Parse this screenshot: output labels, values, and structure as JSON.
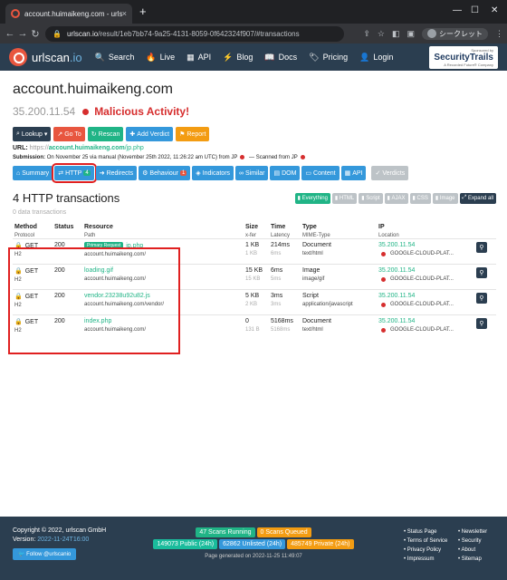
{
  "browser": {
    "tab_title": "account.huimaikeng.com - urlsc",
    "tab_close": "×",
    "new_tab": "+",
    "url_domain": "urlscan.io",
    "url_path": "/result/1eb7bb74-9a25-4131-8059-0f642324f907/#transactions",
    "profile_label": "シークレット"
  },
  "site_nav": {
    "logo_main": "urlscan",
    "logo_suffix": ".io",
    "items": [
      "Search",
      "Live",
      "API",
      "Blog",
      "Docs",
      "Pricing",
      "Login"
    ],
    "sponsor_small": "Sponsored by",
    "sponsor_name": "SecurityTrails",
    "sponsor_sub": "A Recorded Future® Company"
  },
  "page": {
    "domain": "account.huimaikeng.com",
    "ip": "35.200.11.54",
    "verdict": "Malicious Activity!"
  },
  "actions": [
    "Lookup ▾",
    "Go To",
    "Rescan",
    "Add Verdict",
    "Report"
  ],
  "url_info": {
    "label": "URL:",
    "scheme": "https://",
    "domain": "account.huimaikeng.com",
    "path": "/jp.php"
  },
  "submission": {
    "label": "Submission:",
    "text1": "On November 25 via manual (November 25th 2022, 11:26:22 am UTC) from",
    "country1": "JP",
    "text2": "— Scanned from",
    "country2": "JP"
  },
  "tabs": [
    {
      "label": "Summary",
      "badge": ""
    },
    {
      "label": "HTTP",
      "badge": "4"
    },
    {
      "label": "Redirects",
      "badge": ""
    },
    {
      "label": "Behaviour",
      "badge": "1"
    },
    {
      "label": "Indicators",
      "badge": ""
    },
    {
      "label": "Similar",
      "badge": ""
    },
    {
      "label": "DOM",
      "badge": ""
    },
    {
      "label": "Content",
      "badge": ""
    },
    {
      "label": "API",
      "badge": ""
    },
    {
      "label": "Verdicts",
      "badge": ""
    }
  ],
  "transactions": {
    "title": "4 HTTP transactions",
    "subtitle": "0 data transactions",
    "filters": [
      "Everything",
      "HTML",
      "Script",
      "AJAX",
      "CSS",
      "Image"
    ],
    "expand": "Expand all",
    "headers": {
      "method": "Method",
      "protocol": "Protocol",
      "status": "Status",
      "resource": "Resource",
      "path": "Path",
      "size": "Size",
      "xfer": "x-fer",
      "time": "Time",
      "latency": "Latency",
      "type": "Type",
      "mime": "MIME-Type",
      "ip": "IP",
      "location": "Location"
    },
    "rows": [
      {
        "method": "GET",
        "protocol": "H2",
        "status": "200",
        "badge": "Primary Request",
        "file": "jp.php",
        "host": "account.huimaikeng.com/",
        "show": "Show response",
        "size": "1 KB",
        "xfer": "1 KB",
        "time": "214ms",
        "latency": "6ms",
        "type": "Document",
        "mime": "text/html",
        "ip": "35.200.11.54",
        "location": "GOOGLE-CLOUD-PLAT..."
      },
      {
        "method": "GET",
        "protocol": "H2",
        "status": "200",
        "badge": "",
        "file": "loading.gif",
        "host": "account.huimaikeng.com/",
        "show": "",
        "size": "15 KB",
        "xfer": "15 KB",
        "time": "6ms",
        "latency": "5ms",
        "type": "Image",
        "mime": "image/gif",
        "ip": "35.200.11.54",
        "location": "GOOGLE-CLOUD-PLAT..."
      },
      {
        "method": "GET",
        "protocol": "H2",
        "status": "200",
        "badge": "",
        "file": "vendor.23238u92u82.js",
        "host": "account.huimaikeng.com/vendor/",
        "show": "Show response",
        "size": "5 KB",
        "xfer": "2 KB",
        "time": "3ms",
        "latency": "3ms",
        "type": "Script",
        "mime": "application/javascript",
        "ip": "35.200.11.54",
        "location": "GOOGLE-CLOUD-PLAT..."
      },
      {
        "method": "GET",
        "protocol": "H2",
        "status": "200",
        "badge": "",
        "file": "index.php",
        "host": "account.huimaikeng.com/",
        "show": "",
        "size": "0",
        "xfer": "131 B",
        "time": "5168ms",
        "latency": "5168ms",
        "type": "Document",
        "mime": "text/html",
        "ip": "35.200.11.54",
        "location": "GOOGLE-CLOUD-PLAT..."
      }
    ]
  },
  "footer": {
    "copyright": "Copyright © 2022, urlscan GmbH",
    "version_label": "Version:",
    "version": "2022-11-24T16:00",
    "follow": "Follow @urlscanio",
    "running": "47 Scans Running",
    "queued": "0 Scans Queued",
    "public": "149073 Public (24h)",
    "unlisted": "62862 Unlisted (24h)",
    "private": "485749 Private (24h)",
    "generated": "Page generated on 2022-11-25 11:49:07",
    "links1": [
      "Status Page",
      "Terms of Service",
      "Privacy Policy",
      "Impressum"
    ],
    "links2": [
      "Newsletter",
      "Security",
      "About",
      "Sitemap"
    ]
  }
}
